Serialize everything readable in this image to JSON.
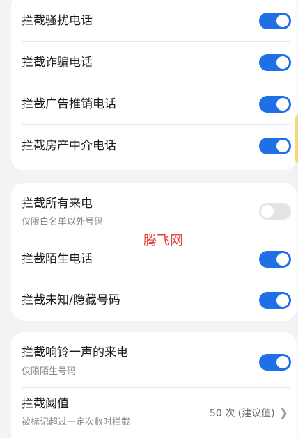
{
  "group1": {
    "items": [
      {
        "label": "拦截骚扰电话",
        "enabled": true
      },
      {
        "label": "拦截诈骗电话",
        "enabled": true
      },
      {
        "label": "拦截广告推销电话",
        "enabled": true
      },
      {
        "label": "拦截房产中介电话",
        "enabled": true
      }
    ]
  },
  "group2": {
    "items": [
      {
        "label": "拦截所有来电",
        "subtitle": "仅限白名单以外号码",
        "enabled": false
      },
      {
        "label": "拦截陌生电话",
        "enabled": true
      },
      {
        "label": "拦截未知/隐藏号码",
        "enabled": true
      }
    ]
  },
  "group3": {
    "ring_once": {
      "label": "拦截响铃一声的来电",
      "subtitle": "仅限陌生号码",
      "enabled": true
    },
    "threshold": {
      "label": "拦截阈值",
      "subtitle": "被标记超过一定次数时拦截",
      "value": "50 次 (建议值)"
    }
  },
  "watermark": "腾飞网",
  "colors": {
    "toggle_on": "#1f6fe6",
    "toggle_off": "#e4e4e6",
    "background": "#f1f3f5"
  }
}
